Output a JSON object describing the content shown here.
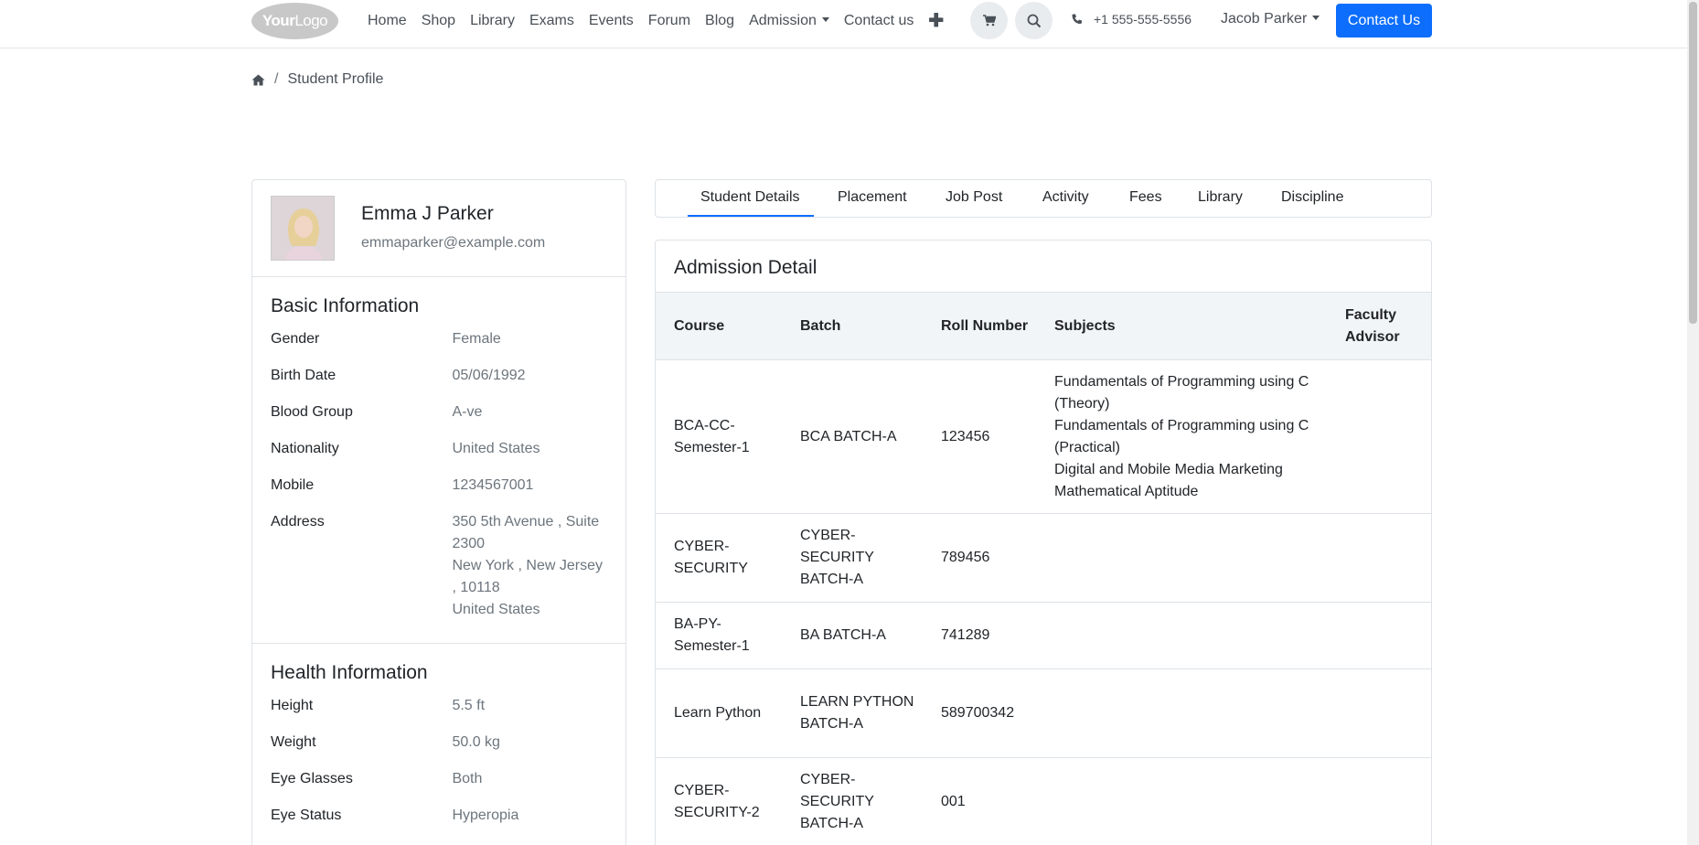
{
  "navbar": {
    "logo": {
      "part1": "Your",
      "part2": "Logo"
    },
    "links": [
      "Home",
      "Shop",
      "Library",
      "Exams",
      "Events",
      "Forum",
      "Blog",
      "Admission",
      "Contact us"
    ],
    "phone": "+1 555-555-5556",
    "user": "Jacob Parker",
    "cta": "Contact Us",
    "icons": [
      "plus-icon",
      "cart-icon",
      "search-icon",
      "phone-icon",
      "home-icon"
    ]
  },
  "breadcrumb": {
    "separator": "/",
    "current": "Student Profile"
  },
  "profile": {
    "name": "Emma J Parker",
    "email": "emmaparker@example.com"
  },
  "basic_info": {
    "title": "Basic Information",
    "rows": [
      {
        "label": "Gender",
        "value": "Female"
      },
      {
        "label": "Birth Date",
        "value": "05/06/1992"
      },
      {
        "label": "Blood Group",
        "value": "A-ve"
      },
      {
        "label": "Nationality",
        "value": "United States"
      },
      {
        "label": "Mobile",
        "value": "1234567001"
      }
    ],
    "address": {
      "label": "Address",
      "line1": "350 5th Avenue , Suite 2300",
      "line2": "New York , New Jersey , 10118",
      "line3": "United States"
    }
  },
  "health_info": {
    "title": "Health Information",
    "rows": [
      {
        "label": "Height",
        "value": "5.5 ft"
      },
      {
        "label": "Weight",
        "value": "50.0 kg"
      },
      {
        "label": "Eye Glasses",
        "value": "Both"
      },
      {
        "label": "Eye Status",
        "value": "Hyperopia"
      }
    ]
  },
  "tabs": [
    "Student Details",
    "Placement",
    "Job Post",
    "Activity",
    "Fees",
    "Library",
    "Discipline"
  ],
  "admission": {
    "title": "Admission Detail",
    "headers": {
      "course": "Course",
      "batch": "Batch",
      "roll": "Roll Number",
      "subjects": "Subjects",
      "advisor": "Faculty Advisor"
    },
    "rows": [
      {
        "course": "BCA-CC-Semester-1",
        "batch": "BCA BATCH-A",
        "roll": "123456",
        "subjects": [
          "Fundamentals of Programming using C (Theory)",
          "Fundamentals of Programming using C (Practical)",
          "Digital and Mobile Media Marketing",
          "Mathematical Aptitude"
        ],
        "advisor": ""
      },
      {
        "course": "CYBER-SECURITY",
        "batch": "CYBER-SECURITY BATCH-A",
        "roll": "789456",
        "subjects": [],
        "advisor": ""
      },
      {
        "course": "BA-PY-Semester-1",
        "batch": "BA BATCH-A",
        "roll": "741289",
        "subjects": [],
        "advisor": ""
      },
      {
        "course": "Learn Python",
        "batch": "LEARN PYTHON BATCH-A",
        "roll": "589700342",
        "subjects": [],
        "advisor": ""
      },
      {
        "course": "CYBER-SECURITY-2",
        "batch": "CYBER-SECURITY BATCH-A",
        "roll": "001",
        "subjects": [],
        "advisor": ""
      }
    ]
  },
  "colors": {
    "primary": "#0d6efd",
    "muted": "#6c757d",
    "border": "#dee2e6",
    "table_head": "#f2f5f8"
  }
}
